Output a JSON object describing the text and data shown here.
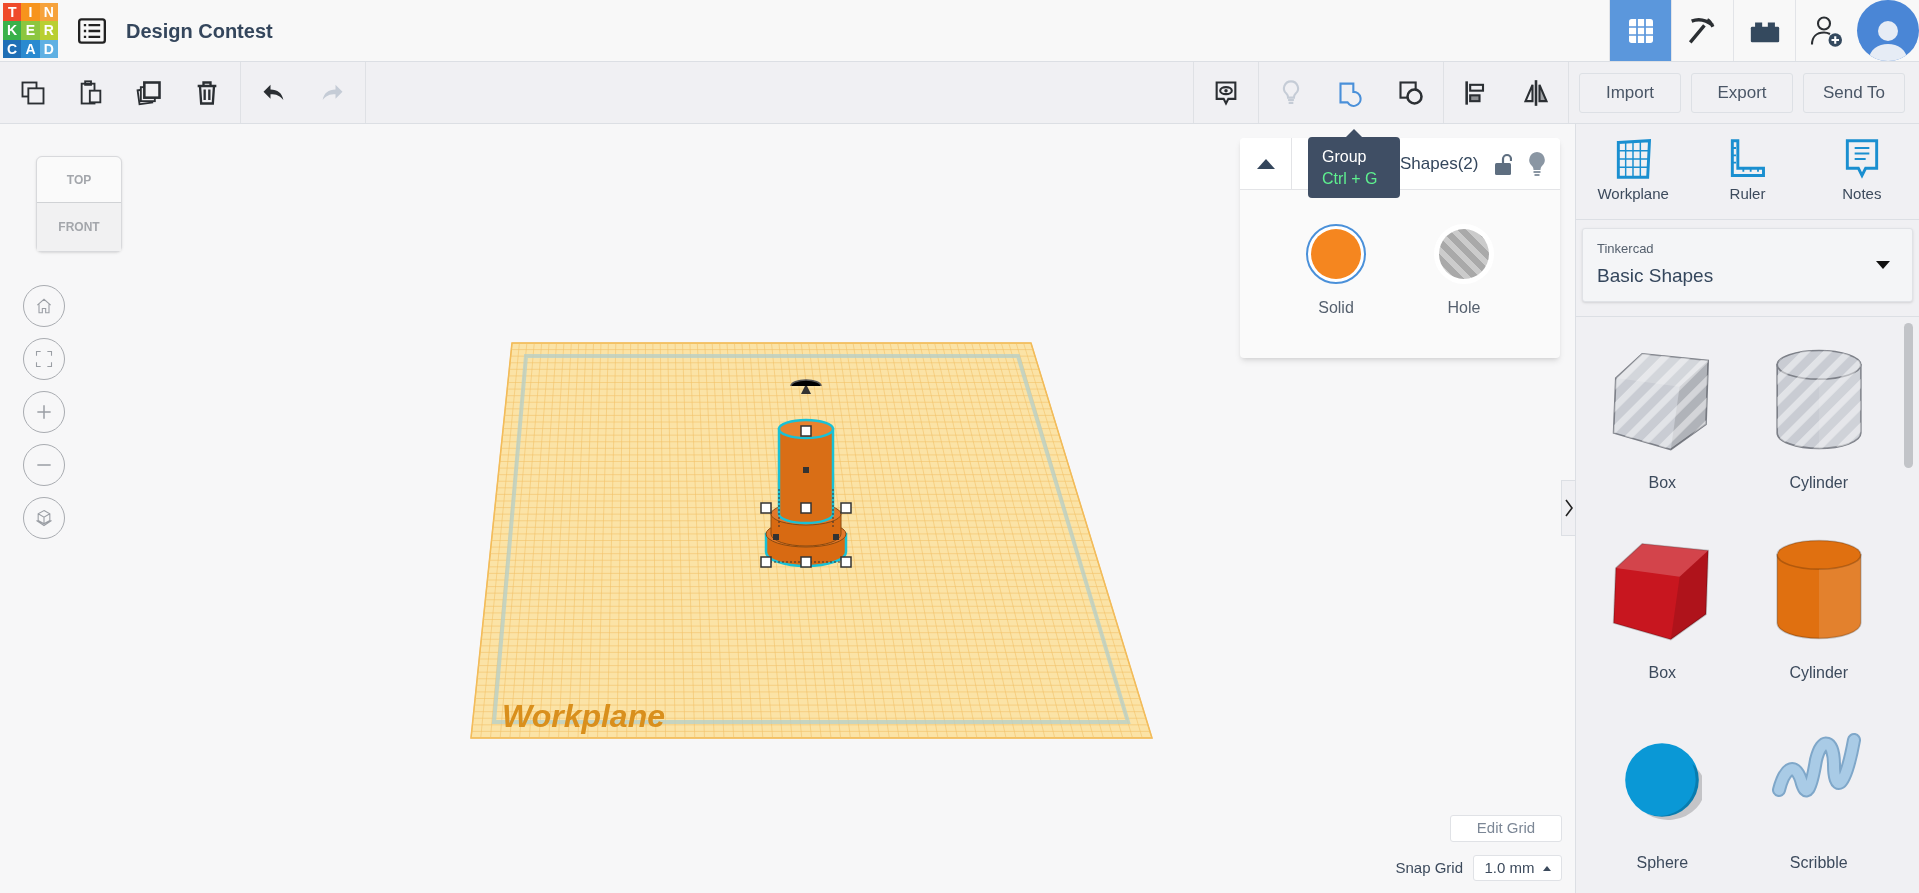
{
  "header": {
    "logo_letters": [
      "T",
      "I",
      "N",
      "K",
      "E",
      "R",
      "C",
      "A",
      "D"
    ],
    "title": "Design Contest",
    "view_buttons": [
      {
        "kind": "grid",
        "selected": true
      },
      {
        "kind": "pickaxe",
        "selected": false
      },
      {
        "kind": "brick",
        "selected": false
      },
      {
        "kind": "add-user",
        "selected": false
      }
    ]
  },
  "toolbar": {
    "edit_tools": [
      {
        "kind": "copy",
        "disabled": false
      },
      {
        "kind": "paste",
        "disabled": false
      },
      {
        "kind": "duplicate",
        "disabled": false
      },
      {
        "kind": "delete",
        "disabled": false
      },
      {
        "kind": "undo",
        "disabled": false
      },
      {
        "kind": "redo",
        "disabled": true
      }
    ],
    "view_tools": [
      {
        "kind": "notes",
        "disabled": false,
        "hovered": false
      },
      {
        "kind": "bulb",
        "disabled": true,
        "hovered": false
      },
      {
        "kind": "group",
        "disabled": false,
        "hovered": true
      },
      {
        "kind": "ungroup",
        "disabled": false,
        "hovered": false
      },
      {
        "kind": "align",
        "disabled": false,
        "hovered": false
      },
      {
        "kind": "mirror",
        "disabled": false,
        "hovered": false
      }
    ],
    "actions": [
      "Import",
      "Export",
      "Send To"
    ]
  },
  "tooltip": {
    "title": "Group",
    "shortcut": "Ctrl + G"
  },
  "view_cube": {
    "top": "TOP",
    "front": "FRONT"
  },
  "nav_controls": [
    {
      "kind": "home"
    },
    {
      "kind": "fit"
    },
    {
      "kind": "zoom-in"
    },
    {
      "kind": "zoom-out"
    },
    {
      "kind": "perspective"
    }
  ],
  "workplane": {
    "label": "Workplane"
  },
  "inspector": {
    "title": "Shapes(2)",
    "locked": false,
    "options": [
      {
        "kind": "solid",
        "label": "Solid",
        "selected": true
      },
      {
        "kind": "hole",
        "label": "Hole",
        "selected": false
      }
    ]
  },
  "right_panel": {
    "tools": [
      {
        "kind": "workplane",
        "label": "Workplane"
      },
      {
        "kind": "ruler",
        "label": "Ruler"
      },
      {
        "kind": "notes",
        "label": "Notes"
      }
    ],
    "library": {
      "source": "Tinkercad",
      "name": "Basic Shapes"
    },
    "shapes": [
      {
        "kind": "box",
        "label": "Box",
        "hole": true,
        "color": "#c9ccd3"
      },
      {
        "kind": "cylinder",
        "label": "Cylinder",
        "hole": true,
        "color": "#c9ccd3"
      },
      {
        "kind": "box",
        "label": "Box",
        "hole": false,
        "color": "#c8161f"
      },
      {
        "kind": "cylinder",
        "label": "Cylinder",
        "hole": false,
        "color": "#e07010"
      },
      {
        "kind": "sphere",
        "label": "Sphere",
        "hole": false,
        "color": "#0a98d6"
      },
      {
        "kind": "scribble",
        "label": "Scribble",
        "hole": false,
        "color": "#a9cbe6"
      }
    ]
  },
  "grid_controls": {
    "edit_button": "Edit Grid",
    "snap_label": "Snap Grid",
    "snap_value": "1.0 mm"
  }
}
